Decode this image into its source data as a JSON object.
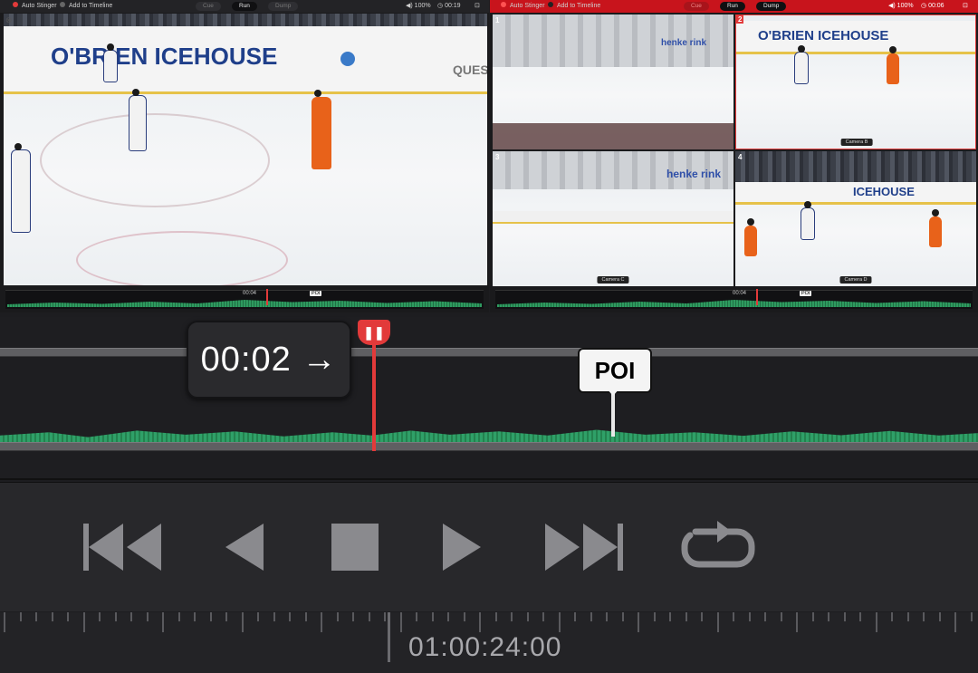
{
  "left_viewer": {
    "auto_stinger": "Auto Stinger",
    "add_to_timeline": "Add to Timeline",
    "cue": "Cue",
    "run": "Run",
    "dump": "Dump",
    "volume": "100%",
    "duration": "00:19",
    "scrub_time": "00:04",
    "poi": "POI",
    "board_text": "O'BRIEN ICEHOUSE",
    "board_text_2": "QUES"
  },
  "right_viewer": {
    "auto_stinger": "Auto Stinger",
    "add_to_timeline": "Add to Timeline",
    "cue": "Cue",
    "run": "Run",
    "dump": "Dump",
    "volume": "100%",
    "duration": "00:06",
    "scrub_time": "00:04",
    "poi": "POI",
    "cameras": [
      {
        "num": "1",
        "label": "",
        "board": "henke rink"
      },
      {
        "num": "2",
        "label": "Camera B",
        "board": "O'BRIEN ICEHOUSE"
      },
      {
        "num": "3",
        "label": "Camera C",
        "board": "henke rink"
      },
      {
        "num": "4",
        "label": "Camera D",
        "board": "ICEHOUSE"
      }
    ]
  },
  "scrubber": {
    "time_bubble": "00:02 →",
    "poi_label": "POI",
    "playhead_icon": "pause-icon"
  },
  "transport": {
    "buttons": [
      "skip-back-icon",
      "step-back-icon",
      "stop-icon",
      "play-icon",
      "skip-forward-icon",
      "loop-icon"
    ]
  },
  "ruler": {
    "timecode": "01:00:24:00"
  },
  "colors": {
    "accent_red": "#e23a3a",
    "live_red_bar": "#c8141c",
    "waveform_green": "#2fa068"
  }
}
